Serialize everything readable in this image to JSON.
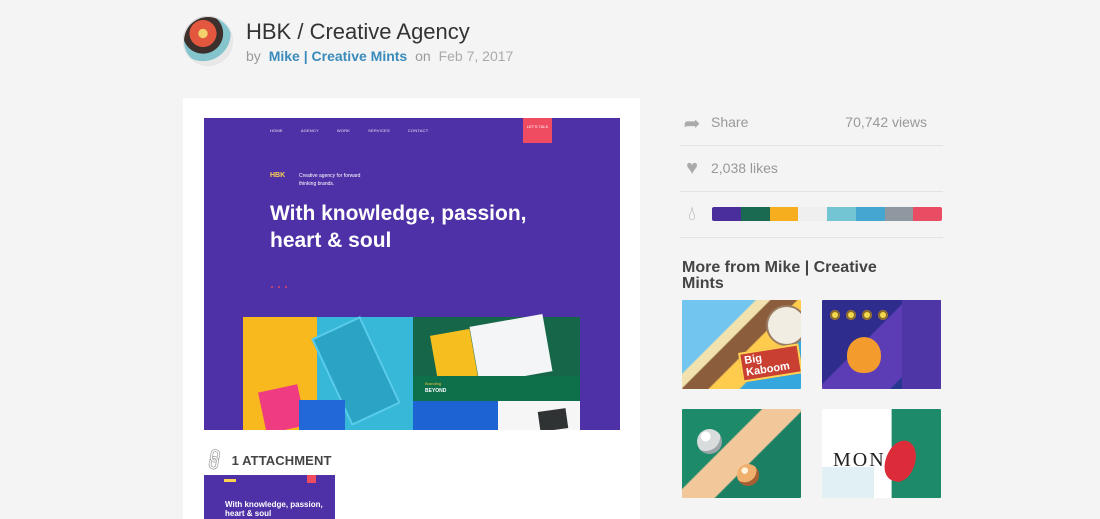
{
  "header": {
    "title": "HBK / Creative Agency",
    "by": "by",
    "author": "Mike | Creative Mints",
    "on": "on",
    "date": "Feb 7, 2017"
  },
  "shot": {
    "nav": [
      "HOME",
      "AGENCY",
      "WORK",
      "SERVICES",
      "CONTACT"
    ],
    "cta": "LET'S TALK",
    "brand": "HBK",
    "tagline": "Creative agency for forward thinking brands.",
    "headline": "With knowledge, passion, heart & soul",
    "branding_label": "Branding",
    "beyond": "BEYOND"
  },
  "attachments": {
    "label": "1 ATTACHMENT",
    "thumb_headline": "With knowledge, passion, heart & soul"
  },
  "stats": {
    "share": "Share",
    "views": "70,742 views",
    "likes": "2,038 likes"
  },
  "palette": [
    "#4a2f9c",
    "#1a6a52",
    "#f6ad1e",
    "#efefef",
    "#73c5d3",
    "#45a6d1",
    "#8f97a0",
    "#e84d64"
  ],
  "more": {
    "title": "More from Mike | Creative Mints",
    "tiles": [
      {
        "alt": "Big Kaboom game artwork",
        "badge": "Big Kaboom"
      },
      {
        "alt": "Purple game screen"
      },
      {
        "alt": "Metallic spheres scene"
      },
      {
        "alt": "Mono editorial layout",
        "word": "MONO"
      }
    ]
  }
}
